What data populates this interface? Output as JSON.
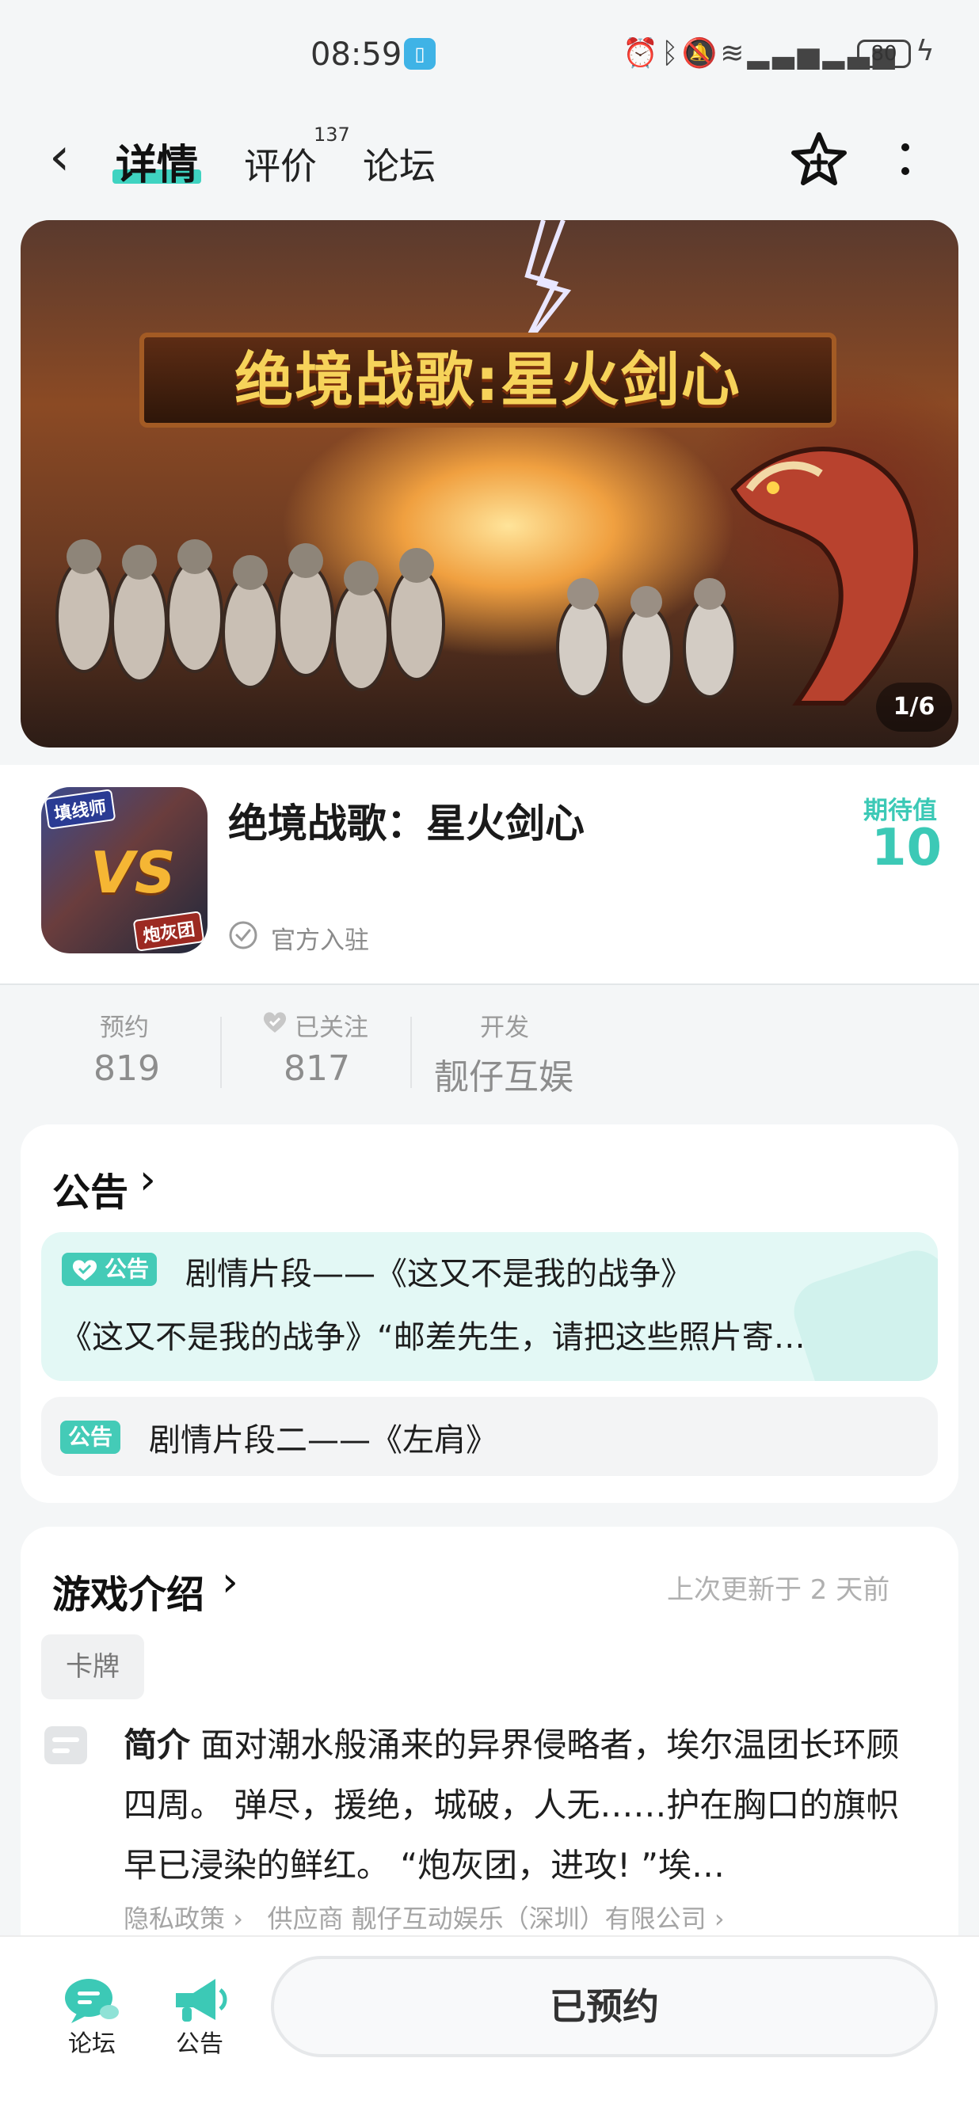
{
  "status_bar": {
    "time": "08:59",
    "battery": "80",
    "icons": [
      "alarm-icon",
      "bluetooth-icon",
      "mute-icon",
      "wifi-icon",
      "signal-icon",
      "signal-icon"
    ]
  },
  "nav": {
    "tabs": [
      {
        "label": "详情",
        "active": true
      },
      {
        "label": "评价",
        "count": "137"
      },
      {
        "label": "论坛"
      }
    ]
  },
  "banner": {
    "title": "绝境战歌:星火剑心",
    "counter": "1/6"
  },
  "game": {
    "title": "绝境战歌：星火剑心",
    "icon_tag_top": "填线师",
    "icon_tag_bottom": "炮灰团",
    "icon_center": "VS",
    "official": "官方入驻",
    "expect_label": "期待值",
    "expect_value": "10"
  },
  "stats": [
    {
      "label": "预约",
      "value": "819"
    },
    {
      "label": "已关注",
      "value": "817"
    },
    {
      "label": "开发",
      "value": "靓仔互娱"
    }
  ],
  "notice": {
    "header": "公告",
    "items": [
      {
        "badge": "公告",
        "title": "剧情片段——《这又不是我的战争》",
        "subtitle": "《这又不是我的战争》“邮差先生，请把这些照片寄…"
      },
      {
        "badge": "公告",
        "title": "剧情片段二——《左肩》"
      }
    ]
  },
  "intro": {
    "header": "游戏介绍",
    "updated": "上次更新于 2 天前",
    "tag": "卡牌",
    "summary_label": "简介",
    "summary_text": "面对潮水般涌来的异界侵略者，埃尔温团长环顾四周。 弹尽，援绝，城破，人无……护在胸口的旗帜早已浸染的鲜红。 “炮灰团，进攻! ”埃…",
    "privacy": "隐私政策",
    "supplier": "供应商 靓仔互动娱乐（深圳）有限公司"
  },
  "bottom": {
    "forum": "论坛",
    "notice": "公告",
    "button": "已预约"
  },
  "colors": {
    "accent": "#3cc9b6",
    "badge": "#44cbb7",
    "notice_bg": "#e3f8f5"
  }
}
